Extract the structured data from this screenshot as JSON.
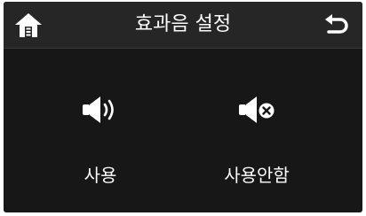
{
  "header": {
    "title": "효과음 설정",
    "home_icon": "home-icon",
    "back_icon": "back-arrow-icon"
  },
  "options": [
    {
      "label": "사용",
      "icon": "speaker-sound-on-icon"
    },
    {
      "label": "사용안함",
      "icon": "speaker-mute-icon"
    }
  ],
  "colors": {
    "background": "#171717",
    "header": "#262626",
    "text": "#ffffff"
  }
}
